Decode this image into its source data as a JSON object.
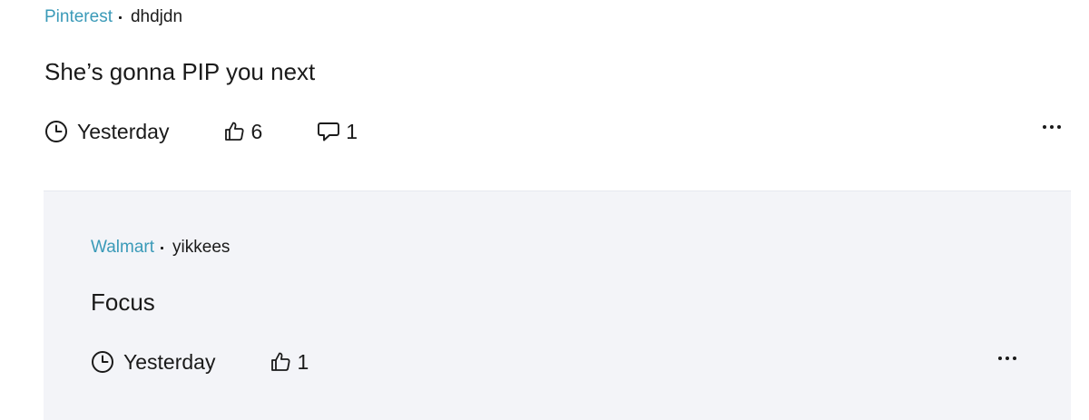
{
  "comment": {
    "company": "Pinterest",
    "author": "dhdjdn",
    "text": "She’s gonna PIP you next",
    "time": "Yesterday",
    "likes": "6",
    "replies": "1",
    "icons": {
      "time": "clock-icon",
      "like": "thumbs-up-icon",
      "reply": "comment-bubble-icon",
      "more": "more-options-icon"
    }
  },
  "reply": {
    "company": "Walmart",
    "author": "yikkees",
    "text": "Focus",
    "time": "Yesterday",
    "likes": "1"
  },
  "colors": {
    "company_link": "#3a9ab8",
    "text": "#1a1a1a",
    "reply_background": "#f3f4f8"
  }
}
